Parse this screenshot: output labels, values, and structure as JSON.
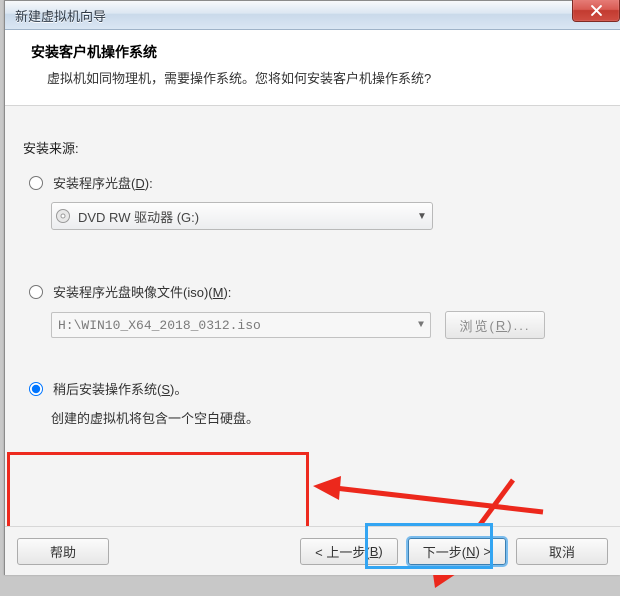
{
  "titlebar": {
    "title": "新建虚拟机向导",
    "close_icon": "x"
  },
  "header": {
    "title": "安装客户机操作系统",
    "subtitle": "虚拟机如同物理机，需要操作系统。您将如何安装客户机操作系统?"
  },
  "body": {
    "source_label": "安装来源:",
    "opt_disc": {
      "label_pre": "安装程序光盘(",
      "accel": "D",
      "label_post": "):",
      "drive_value": "DVD RW 驱动器 (G:)"
    },
    "opt_iso": {
      "label_pre": "安装程序光盘映像文件(iso)(",
      "accel": "M",
      "label_post": "):",
      "path_value": "H:\\WIN10_X64_2018_0312.iso",
      "browse_pre": "浏览(",
      "browse_accel": "R",
      "browse_post": ")..."
    },
    "opt_later": {
      "label_pre": "稍后安装操作系统(",
      "accel": "S",
      "label_post": ")。",
      "desc": "创建的虚拟机将包含一个空白硬盘。"
    }
  },
  "footer": {
    "help": "帮助",
    "back_pre": "< 上一步(",
    "back_accel": "B",
    "back_post": ")",
    "next_pre": "下一步(",
    "next_accel": "N",
    "next_post": ") >",
    "cancel": "取消"
  }
}
